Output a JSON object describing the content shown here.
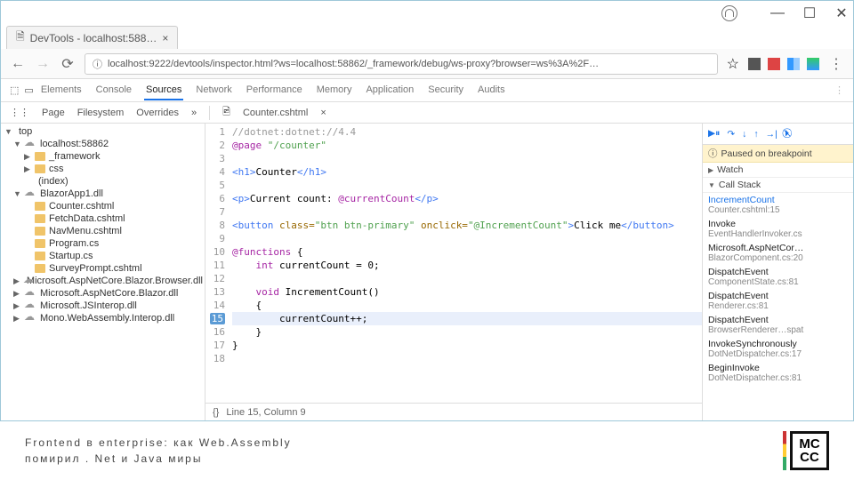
{
  "browser": {
    "tab_title": "DevTools - localhost:588…",
    "url": "localhost:9222/devtools/inspector.html?ws=localhost:58862/_framework/debug/ws-proxy?browser=ws%3A%2F…"
  },
  "devtools": {
    "tabs": [
      "Elements",
      "Console",
      "Sources",
      "Network",
      "Performance",
      "Memory",
      "Application",
      "Security",
      "Audits"
    ],
    "active_tab": "Sources",
    "sub_tabs": [
      "Page",
      "Filesystem",
      "Overrides"
    ],
    "file_tabs": [
      {
        "label": "Counter.cshtml",
        "close": "×"
      }
    ],
    "status": "Line 15, Column 9",
    "status_prefix": "{}"
  },
  "tree": [
    {
      "lvl": 0,
      "icon": "tw",
      "label": "top",
      "exp": "▼"
    },
    {
      "lvl": 1,
      "icon": "cloud",
      "label": "localhost:58862",
      "exp": "▼"
    },
    {
      "lvl": 2,
      "icon": "folder",
      "label": "_framework",
      "exp": "▶"
    },
    {
      "lvl": 2,
      "icon": "folder",
      "label": "css",
      "exp": "▶"
    },
    {
      "lvl": 2,
      "icon": "file",
      "label": "(index)",
      "exp": ""
    },
    {
      "lvl": 1,
      "icon": "cloud",
      "label": "BlazorApp1.dll",
      "exp": "▼"
    },
    {
      "lvl": 2,
      "icon": "folder",
      "label": "Counter.cshtml",
      "exp": ""
    },
    {
      "lvl": 2,
      "icon": "folder",
      "label": "FetchData.cshtml",
      "exp": ""
    },
    {
      "lvl": 2,
      "icon": "folder",
      "label": "NavMenu.cshtml",
      "exp": ""
    },
    {
      "lvl": 2,
      "icon": "folder",
      "label": "Program.cs",
      "exp": ""
    },
    {
      "lvl": 2,
      "icon": "folder",
      "label": "Startup.cs",
      "exp": ""
    },
    {
      "lvl": 2,
      "icon": "folder",
      "label": "SurveyPrompt.cshtml",
      "exp": ""
    },
    {
      "lvl": 1,
      "icon": "cloud",
      "label": "Microsoft.AspNetCore.Blazor.Browser.dll",
      "exp": "▶"
    },
    {
      "lvl": 1,
      "icon": "cloud",
      "label": "Microsoft.AspNetCore.Blazor.dll",
      "exp": "▶"
    },
    {
      "lvl": 1,
      "icon": "cloud",
      "label": "Microsoft.JSInterop.dll",
      "exp": "▶"
    },
    {
      "lvl": 1,
      "icon": "cloud",
      "label": "Mono.WebAssembly.Interop.dll",
      "exp": "▶"
    }
  ],
  "code": {
    "lines": [
      {
        "n": 1,
        "html": "<span class='c-cm'>//dotnet:dotnet://4.4</span>"
      },
      {
        "n": 2,
        "html": "<span class='c-kw'>@page</span> <span class='c-str'>\"/counter\"</span>"
      },
      {
        "n": 3,
        "html": ""
      },
      {
        "n": 4,
        "html": "<span class='c-tag'>&lt;h1&gt;</span>Counter<span class='c-tag'>&lt;/h1&gt;</span>"
      },
      {
        "n": 5,
        "html": ""
      },
      {
        "n": 6,
        "html": "<span class='c-tag'>&lt;p&gt;</span>Current count: <span class='c-kw'>@currentCount</span><span class='c-tag'>&lt;/p&gt;</span>"
      },
      {
        "n": 7,
        "html": ""
      },
      {
        "n": 8,
        "html": "<span class='c-tag'>&lt;button</span> <span class='c-attr'>class=</span><span class='c-str'>\"btn btn-primary\"</span> <span class='c-attr'>onclick=</span><span class='c-str'>\"@IncrementCount\"</span><span class='c-tag'>&gt;</span>Click me<span class='c-tag'>&lt;/button&gt;</span>"
      },
      {
        "n": 9,
        "html": ""
      },
      {
        "n": 10,
        "html": "<span class='c-kw'>@functions</span> {"
      },
      {
        "n": 11,
        "html": "    <span class='c-kw'>int</span> currentCount = 0;"
      },
      {
        "n": 12,
        "html": ""
      },
      {
        "n": 13,
        "html": "    <span class='c-kw'>void</span> IncrementCount()"
      },
      {
        "n": 14,
        "html": "    {"
      },
      {
        "n": 15,
        "html": "        currentCount++;",
        "bp": true,
        "hl": true
      },
      {
        "n": 16,
        "html": "    }"
      },
      {
        "n": 17,
        "html": "}"
      },
      {
        "n": 18,
        "html": ""
      }
    ]
  },
  "debug": {
    "paused": "Paused on breakpoint",
    "sections": {
      "watch": "Watch",
      "call_stack": "Call Stack"
    },
    "stack": [
      {
        "fn": "IncrementCount",
        "src": "Counter.cshtml:15",
        "blue": true
      },
      {
        "fn": "Invoke",
        "src": "EventHandlerInvoker.cs"
      },
      {
        "fn": "Microsoft.AspNetCor…",
        "src": "BlazorComponent.cs:20"
      },
      {
        "fn": "DispatchEvent",
        "src": "ComponentState.cs:81"
      },
      {
        "fn": "DispatchEvent",
        "src": "Renderer.cs:81"
      },
      {
        "fn": "DispatchEvent",
        "src": "BrowserRenderer…spat"
      },
      {
        "fn": "InvokeSynchronously",
        "src": "DotNetDispatcher.cs:17"
      },
      {
        "fn": "BeginInvoke",
        "src": "DotNetDispatcher.cs:81"
      }
    ]
  },
  "footer": {
    "line1": "Frontend в enterprise: как Web.Assembly",
    "line2": "помирил . Net и Java миры",
    "logo_top": "MC",
    "logo_bot": "CC"
  }
}
